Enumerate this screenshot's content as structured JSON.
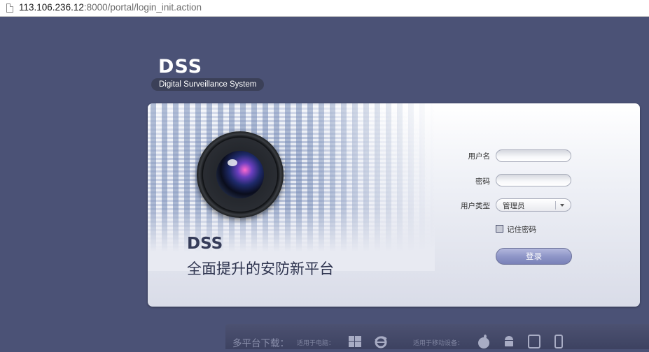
{
  "browser": {
    "url_host": "113.106.236.12",
    "url_rest": ":8000/portal/login_init.action"
  },
  "logo": {
    "title": "DSS",
    "subtitle": "Digital Surveillance System"
  },
  "panel": {
    "brand": "DSS",
    "slogan": "全面提升的安防新平台"
  },
  "form": {
    "username_label": "用户名",
    "username_value": "",
    "password_label": "密码",
    "password_value": "",
    "usertype_label": "用户类型",
    "usertype_value": "管理员",
    "remember_label": "记住密码",
    "login_button": "登录"
  },
  "download_bar": {
    "title": "多平台下载：",
    "pc_label": "适用于电脑：",
    "mobile_label": "适用于移动设备："
  },
  "icons": [
    "page-icon",
    "windows-icon",
    "ie-icon",
    "apple-icon",
    "android-icon",
    "tablet-icon",
    "phone-icon"
  ],
  "colors": {
    "background": "#4b5276",
    "button": "#8f96c8",
    "text_dark": "#2f3550"
  }
}
